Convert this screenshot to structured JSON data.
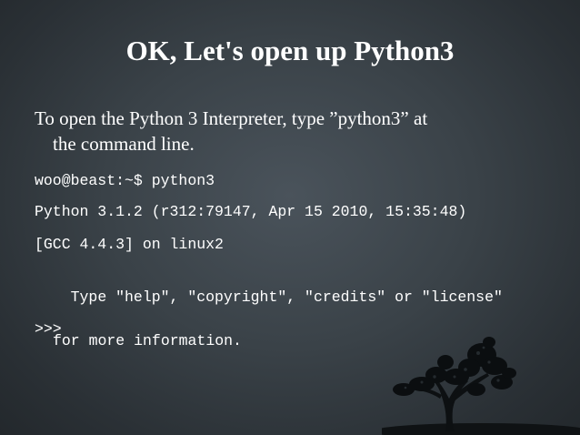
{
  "slide": {
    "title": "OK, Let's open up Python3",
    "intro_line1": "To open the Python 3 Interpreter, type ”python3” at",
    "intro_line2": "the command line.",
    "code": {
      "prompt_command": "woo@beast:~$ python3",
      "version_line": "Python 3.1.2 (r312:79147, Apr 15 2010, 15:35:48)",
      "gcc_line": "[GCC 4.4.3] on linux2",
      "help_line1": "Type \"help\", \"copyright\", \"credits\" or \"license\"",
      "help_line2": "for more information.",
      "repl_prompt": ">>>"
    },
    "decoration": "tree-silhouette",
    "colors": {
      "background_center": "#4a535b",
      "background_edge": "#23282c",
      "text": "#ffffff"
    }
  }
}
